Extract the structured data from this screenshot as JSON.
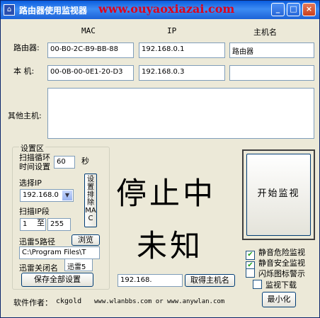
{
  "window": {
    "title": "路由器使用监视器",
    "watermark": "www.ouyaoxiazai.com",
    "min_glyph": "_",
    "max_glyph": "□",
    "close_glyph": "×"
  },
  "columns": {
    "mac": "MAC",
    "ip": "IP",
    "hostname": "主机名"
  },
  "router": {
    "label": "路由器:",
    "mac": "00-B0-2C-B9-BB-88",
    "ip": "192.168.0.1",
    "hostname": "路由器"
  },
  "local": {
    "label": "本  机:",
    "mac": "00-0B-00-0E1-20-D3",
    "ip": "192.168.0.3",
    "hostname": ""
  },
  "other_hosts": {
    "label": "其他主机:",
    "value": ""
  },
  "settings": {
    "group_label": "设置区",
    "scan_interval_label_1": "扫描循环",
    "scan_interval_label_2": "时间设置",
    "scan_interval_value": "60",
    "seconds_unit": "秒",
    "select_ip_label": "选择IP",
    "select_ip_value": "192.168.0",
    "ip_range_label": "扫描IP段",
    "ip_range_from": "1",
    "ip_range_to_label": "至",
    "ip_range_to": "255",
    "exclude_mac_button": "设置排除MAC",
    "thunder_path_label": "迅雷5路径",
    "browse_button": "浏览",
    "thunder_path_value": "C:\\Program Files\\T",
    "thunder_close_label": "迅雷关闭名",
    "thunder_close_value": "迅雷5",
    "save_all_button": "保存全部设置"
  },
  "status": {
    "line1": "停止中",
    "line2": "未知"
  },
  "start_button": "开始监视",
  "host_lookup": {
    "ip_value": "192.168.",
    "button": "取得主机名"
  },
  "options": [
    {
      "label": "静音危险监视",
      "checked": true
    },
    {
      "label": "静音安全监视",
      "checked": true
    },
    {
      "label": "闪烁图标警示",
      "checked": false
    },
    {
      "label": "监视下载",
      "checked": false
    }
  ],
  "check_glyph": "✔",
  "minimize_button": "最小化",
  "footer": {
    "author_label": "软件作者：",
    "author": "ckgold",
    "sites": "www.wlanbbs.com or www.anywlan.com"
  },
  "colors": {
    "watermark": "#e0001a",
    "titlebar": "#0a5ddf",
    "check": "#21a121"
  }
}
